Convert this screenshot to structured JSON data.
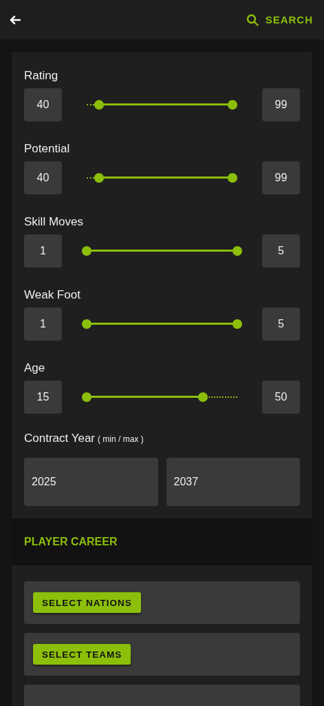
{
  "header": {
    "search_label": "SEARCH"
  },
  "sliders": [
    {
      "label": "Rating",
      "min_value": "40",
      "max_value": "99",
      "thumbs": [
        {
          "level": 0.08
        },
        {
          "level": 0.97
        }
      ]
    },
    {
      "label": "Potential",
      "min_value": "40",
      "max_value": "99",
      "thumbs": [
        {
          "level": 0.08
        },
        {
          "level": 0.97
        }
      ]
    },
    {
      "label": "Skill Moves",
      "min_value": "1",
      "max_value": "5",
      "thumbs": [
        {
          "level": 0
        },
        {
          "level": 1
        }
      ]
    },
    {
      "label": "Weak Foot",
      "min_value": "1",
      "max_value": "5",
      "thumbs": [
        {
          "level": 0
        },
        {
          "level": 1
        }
      ]
    },
    {
      "label": "Age",
      "min_value": "15",
      "max_value": "50",
      "thumbs": [
        {
          "level": 0
        },
        {
          "level": 0.77
        }
      ]
    }
  ],
  "contract_year": {
    "label": "Contract Year",
    "hint": "( min / max )",
    "min_value": "2025",
    "max_value": "2037"
  },
  "player_career": {
    "title": "PLAYER CAREER",
    "items": [
      {
        "kind": "button",
        "label": "SELECT NATIONS"
      },
      {
        "kind": "button",
        "label": "SELECT TEAMS"
      },
      {
        "kind": "blank"
      }
    ]
  }
}
